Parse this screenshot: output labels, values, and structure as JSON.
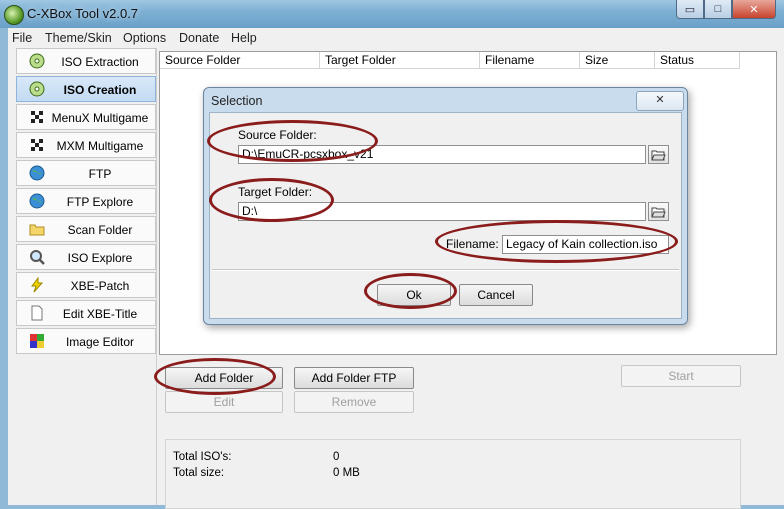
{
  "window": {
    "title": "C-XBox Tool v2.0.7",
    "min_glyph": "▭",
    "max_glyph": "□",
    "close_glyph": "✕"
  },
  "menu": [
    "File",
    "Theme/Skin",
    "Options",
    "Donate",
    "Help"
  ],
  "sidebar": [
    {
      "label": "ISO Extraction",
      "icon": "disc-icon"
    },
    {
      "label": "ISO Creation",
      "icon": "disc-icon",
      "active": true
    },
    {
      "label": "MenuX Multigame",
      "icon": "checkered-flag-icon"
    },
    {
      "label": "MXM Multigame",
      "icon": "checkered-flag-icon"
    },
    {
      "label": "FTP",
      "icon": "globe-icon"
    },
    {
      "label": "FTP Explore",
      "icon": "globe-icon"
    },
    {
      "label": "Scan Folder",
      "icon": "folder-icon"
    },
    {
      "label": "ISO Explore",
      "icon": "magnifier-disc-icon"
    },
    {
      "label": "XBE-Patch",
      "icon": "lightning-icon"
    },
    {
      "label": "Edit XBE-Title",
      "icon": "document-icon"
    },
    {
      "label": "Image Editor",
      "icon": "palette-icon"
    }
  ],
  "table": {
    "columns": [
      "Source Folder",
      "Target Folder",
      "Filename",
      "Size",
      "Status"
    ]
  },
  "buttons": {
    "add_folder": "Add Folder",
    "add_folder_ftp": "Add Folder FTP",
    "start": "Start",
    "edit": "Edit",
    "remove": "Remove"
  },
  "summary": {
    "total_isos_label": "Total ISO's:",
    "total_isos_value": "0",
    "total_size_label": "Total size:",
    "total_size_value": "0 MB"
  },
  "dialog": {
    "title": "Selection",
    "close_glyph": "✕",
    "source_label": "Source Folder:",
    "source_value": "D:\\EmuCR-pcsxbox_v21",
    "target_label": "Target Folder:",
    "target_value": "D:\\",
    "filename_label": "Filename:",
    "filename_value": "Legacy of Kain collection.iso",
    "ok_label": "Ok",
    "cancel_label": "Cancel"
  },
  "colors": {
    "annotation": "#8a1c1c",
    "title_bar": "#7fb0d3",
    "selected_sidebar": "#c3dbf3"
  }
}
